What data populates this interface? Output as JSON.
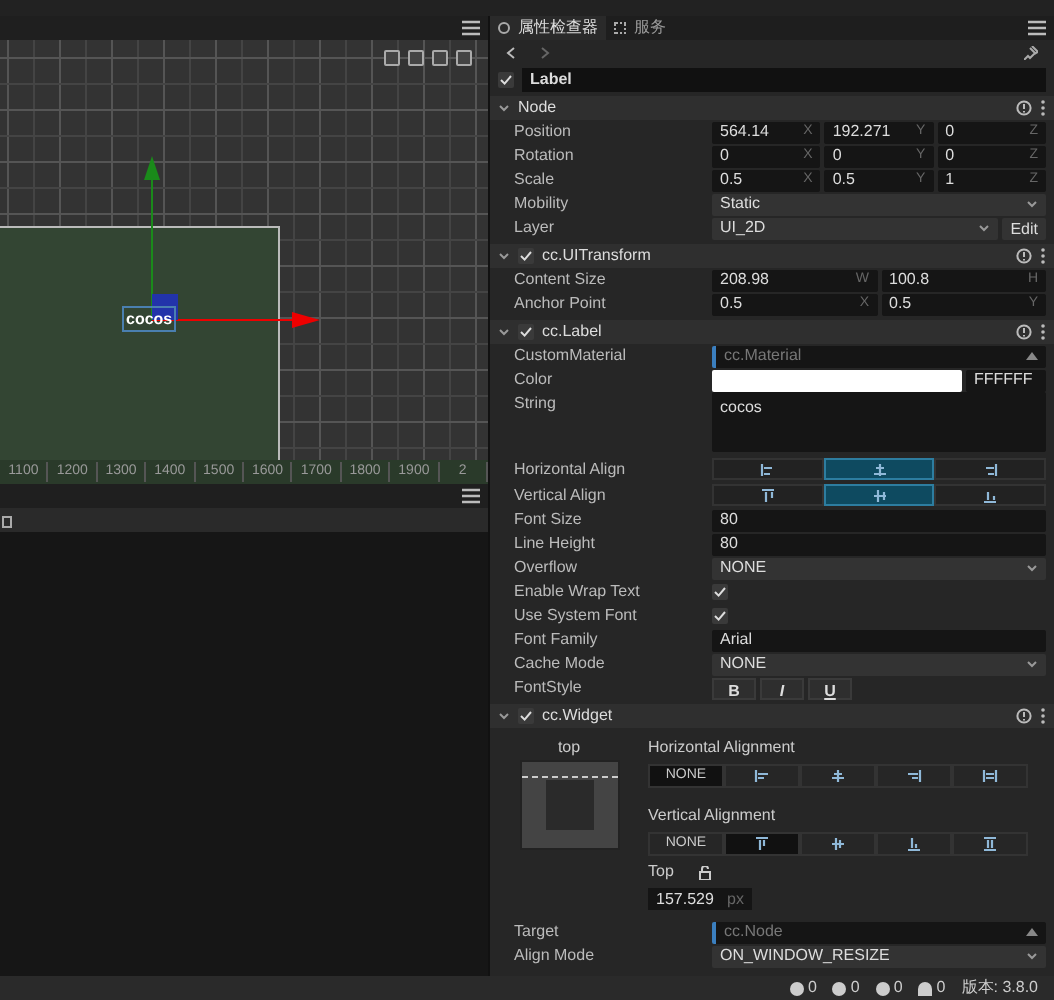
{
  "scene": {
    "node_label": "cocos",
    "ruler": [
      "1100",
      "1200",
      "1300",
      "1400",
      "1500",
      "1600",
      "1700",
      "1800",
      "1900",
      "2"
    ]
  },
  "inspector": {
    "tabs": [
      {
        "label": "属性检查器",
        "selected": true
      },
      {
        "label": "服务",
        "selected": false
      }
    ],
    "node": {
      "name": "Label",
      "enabled": true
    },
    "components": [
      {
        "title": "Node",
        "rows": [
          {
            "kind": "vec",
            "label": "Position",
            "fields": [
              {
                "value": "564.14",
                "axis": "X"
              },
              {
                "value": "192.271",
                "axis": "Y"
              },
              {
                "value": "0",
                "axis": "Z"
              }
            ]
          },
          {
            "kind": "vec",
            "label": "Rotation",
            "fields": [
              {
                "value": "0",
                "axis": "X"
              },
              {
                "value": "0",
                "axis": "Y"
              },
              {
                "value": "0",
                "axis": "Z"
              }
            ]
          },
          {
            "kind": "vec",
            "label": "Scale",
            "fields": [
              {
                "value": "0.5",
                "axis": "X"
              },
              {
                "value": "0.5",
                "axis": "Y"
              },
              {
                "value": "1",
                "axis": "Z"
              }
            ]
          },
          {
            "kind": "select",
            "label": "Mobility",
            "value": "Static"
          },
          {
            "kind": "select_edit",
            "label": "Layer",
            "value": "UI_2D",
            "button": "Edit"
          }
        ]
      },
      {
        "title": "cc.UITransform",
        "enabled": true,
        "rows": [
          {
            "kind": "vec",
            "label": "Content Size",
            "fields": [
              {
                "value": "208.98",
                "axis": "W"
              },
              {
                "value": "100.8",
                "axis": "H"
              }
            ]
          },
          {
            "kind": "vec",
            "label": "Anchor Point",
            "fields": [
              {
                "value": "0.5",
                "axis": "X"
              },
              {
                "value": "0.5",
                "axis": "Y"
              }
            ]
          }
        ]
      },
      {
        "title": "cc.Label",
        "enabled": true,
        "rows": [
          {
            "kind": "asset",
            "label": "CustomMaterial",
            "placeholder": "cc.Material"
          },
          {
            "kind": "color",
            "label": "Color",
            "color": "#ffffff",
            "hex": "FFFFFF"
          },
          {
            "kind": "textarea",
            "label": "String",
            "value": "cocos"
          },
          {
            "kind": "align",
            "label": "Horizontal Align",
            "options": [
              {
                "selected": false
              },
              {
                "selected": true
              },
              {
                "selected": false
              }
            ]
          },
          {
            "kind": "align",
            "label": "Vertical Align",
            "options": [
              {
                "selected": false
              },
              {
                "selected": true
              },
              {
                "selected": false
              }
            ]
          },
          {
            "kind": "input",
            "label": "Font Size",
            "value": "80"
          },
          {
            "kind": "input",
            "label": "Line Height",
            "value": "80"
          },
          {
            "kind": "select",
            "label": "Overflow",
            "value": "NONE"
          },
          {
            "kind": "check",
            "label": "Enable Wrap Text",
            "checked": true
          },
          {
            "kind": "check",
            "label": "Use System Font",
            "checked": true
          },
          {
            "kind": "input",
            "label": "Font Family",
            "value": "Arial"
          },
          {
            "kind": "select",
            "label": "Cache Mode",
            "value": "NONE"
          },
          {
            "kind": "style",
            "label": "FontStyle",
            "buttons": [
              "B",
              "I",
              "U"
            ]
          }
        ]
      },
      {
        "title": "cc.Widget",
        "enabled": true,
        "widget": {
          "preview_label": "top",
          "horizontal": {
            "label": "Horizontal Alignment",
            "options": [
              {
                "label": "NONE",
                "selected": true
              },
              {
                "selected": false
              },
              {
                "selected": false
              },
              {
                "selected": false
              },
              {
                "selected": false
              }
            ]
          },
          "vertical": {
            "label": "Vertical Alignment",
            "options": [
              {
                "label": "NONE",
                "selected": false
              },
              {
                "selected": true
              },
              {
                "selected": false
              },
              {
                "selected": false
              },
              {
                "selected": false
              }
            ]
          },
          "offset": {
            "label": "Top",
            "value": "157.529",
            "unit": "px"
          }
        },
        "rows": [
          {
            "kind": "asset",
            "label": "Target",
            "placeholder": "cc.Node"
          },
          {
            "kind": "select",
            "label": "Align Mode",
            "value": "ON_WINDOW_RESIZE"
          }
        ]
      }
    ]
  },
  "status_bar": {
    "counts": [
      "0",
      "0",
      "0",
      "0"
    ],
    "version": "版本: 3.8.0"
  }
}
